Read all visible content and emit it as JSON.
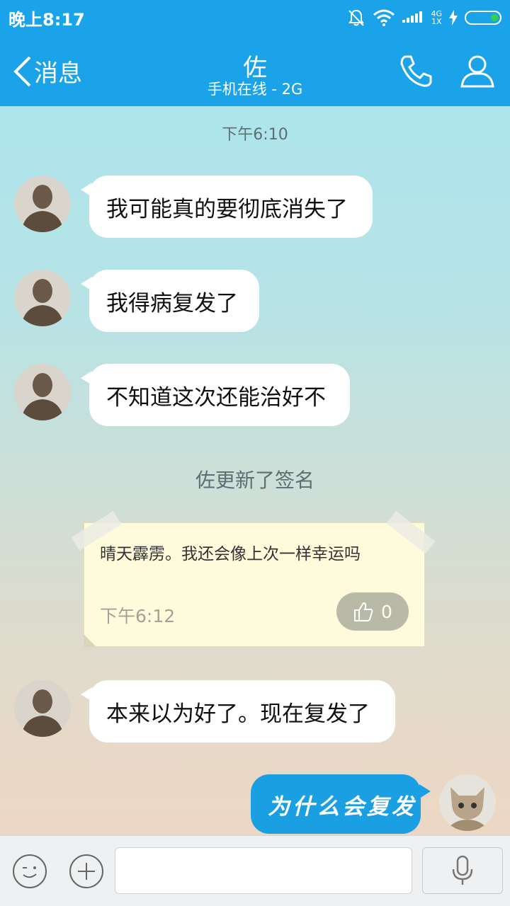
{
  "status_bar": {
    "time": "晚上8:17",
    "network_top": "4G",
    "network_bottom": "1X"
  },
  "header": {
    "back_label": "消息",
    "contact_name": "佐",
    "contact_status": "手机在线 - 2G"
  },
  "chat": {
    "timestamp": "下午6:10",
    "incoming": [
      {
        "text": "我可能真的要彻底消失了"
      },
      {
        "text": "我得病复发了"
      },
      {
        "text": "不知道这次还能治好不"
      }
    ],
    "system_notice": "佐更新了签名",
    "signature_card": {
      "text": "晴天霹雳。我还会像上次一样幸运吗",
      "time": "下午6:12",
      "likes": "0"
    },
    "incoming_after": {
      "text": "本来以为好了。现在复发了"
    },
    "outgoing": {
      "text": "为什么会复发"
    }
  },
  "input_bar": {
    "placeholder": ""
  },
  "colors": {
    "header_blue": "#1aa3e8",
    "outgoing_bubble": "#1aa0e2",
    "battery_green": "#35d14a",
    "note_paper": "#fdfbdc"
  }
}
